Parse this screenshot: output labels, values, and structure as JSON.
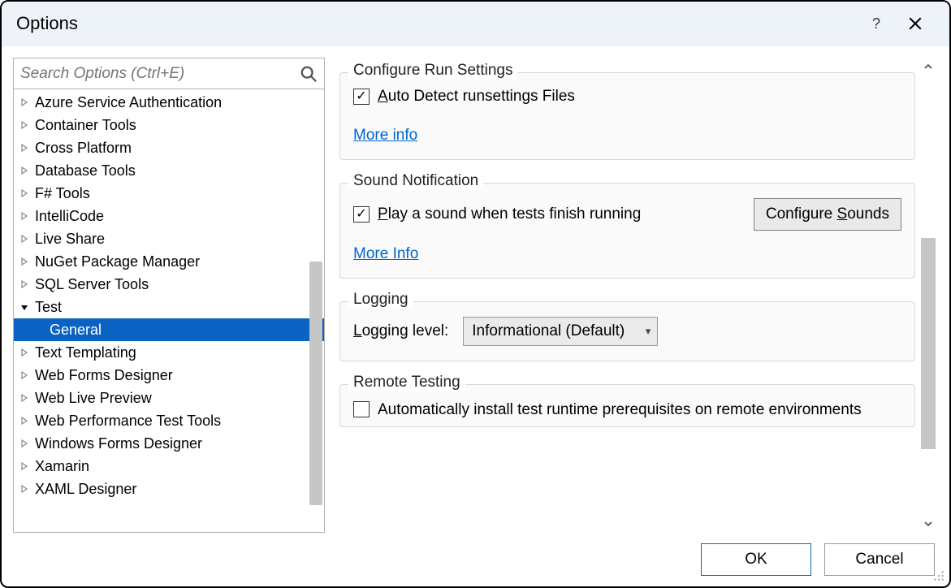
{
  "window": {
    "title": "Options",
    "help_tooltip": "?",
    "search_placeholder": "Search Options (Ctrl+E)"
  },
  "tree": {
    "items": [
      {
        "label": "Azure Service Authentication",
        "expanded": false,
        "selected": false
      },
      {
        "label": "Container Tools",
        "expanded": false,
        "selected": false
      },
      {
        "label": "Cross Platform",
        "expanded": false,
        "selected": false
      },
      {
        "label": "Database Tools",
        "expanded": false,
        "selected": false
      },
      {
        "label": "F# Tools",
        "expanded": false,
        "selected": false
      },
      {
        "label": "IntelliCode",
        "expanded": false,
        "selected": false
      },
      {
        "label": "Live Share",
        "expanded": false,
        "selected": false
      },
      {
        "label": "NuGet Package Manager",
        "expanded": false,
        "selected": false
      },
      {
        "label": "SQL Server Tools",
        "expanded": false,
        "selected": false
      },
      {
        "label": "Test",
        "expanded": true,
        "selected": false,
        "children": [
          {
            "label": "General",
            "selected": true
          }
        ]
      },
      {
        "label": "Text Templating",
        "expanded": false,
        "selected": false
      },
      {
        "label": "Web Forms Designer",
        "expanded": false,
        "selected": false
      },
      {
        "label": "Web Live Preview",
        "expanded": false,
        "selected": false
      },
      {
        "label": "Web Performance Test Tools",
        "expanded": false,
        "selected": false
      },
      {
        "label": "Windows Forms Designer",
        "expanded": false,
        "selected": false
      },
      {
        "label": "Xamarin",
        "expanded": false,
        "selected": false
      },
      {
        "label": "XAML Designer",
        "expanded": false,
        "selected": false
      }
    ]
  },
  "sections": {
    "run_settings": {
      "legend": "Configure Run Settings",
      "auto_detect_label": "Auto Detect runsettings Files",
      "auto_detect_checked": true,
      "more_info": "More info"
    },
    "sound": {
      "legend": "Sound Notification",
      "play_sound_label": "Play a sound when tests finish running",
      "play_sound_checked": true,
      "configure_button": "Configure Sounds",
      "more_info": "More Info"
    },
    "logging": {
      "legend": "Logging",
      "level_label": "Logging level:",
      "level_value": "Informational (Default)"
    },
    "remote": {
      "legend": "Remote Testing",
      "auto_install_label": "Automatically install test runtime prerequisites on remote environments",
      "auto_install_checked": false
    }
  },
  "footer": {
    "ok": "OK",
    "cancel": "Cancel"
  }
}
